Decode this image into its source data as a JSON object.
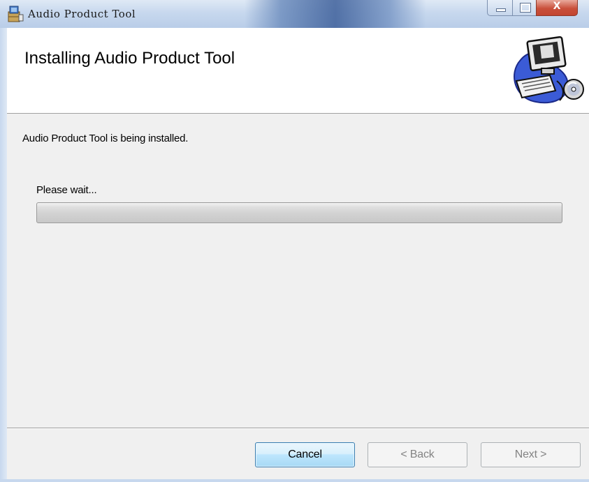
{
  "window": {
    "title": "Audio Product Tool",
    "icon": "installer-icon",
    "controls": {
      "minimize": "minimize-icon",
      "maximize": "maximize-icon",
      "close_symbol": "X"
    }
  },
  "header": {
    "title": "Installing Audio Product Tool",
    "image": "computer-install-icon"
  },
  "body": {
    "status_text": "Audio Product Tool is being installed.",
    "wait_text": "Please wait...",
    "progress": 0
  },
  "buttons": {
    "cancel": "Cancel",
    "back": "< Back",
    "next": "Next >"
  },
  "colors": {
    "accent_button": "#bee6fd",
    "close_button": "#c9503b"
  }
}
